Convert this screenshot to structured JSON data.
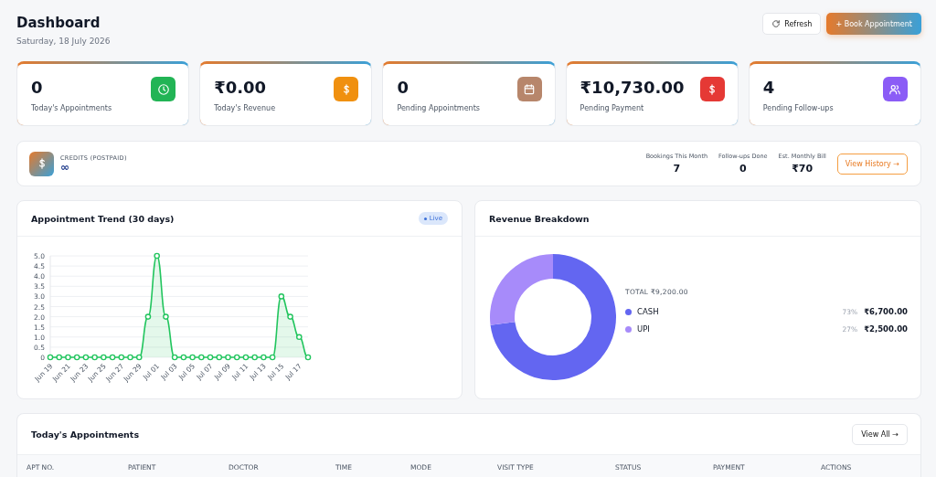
{
  "header": {
    "title": "Dashboard",
    "date": "Saturday, 18 July 2026",
    "buttons": [
      {
        "kind": "refresh",
        "label": "Refresh"
      },
      {
        "kind": "primary",
        "label": "+ Book Appointment"
      }
    ]
  },
  "stats": [
    {
      "value": "0",
      "label": "Today's Appointments",
      "color": "#22b455"
    },
    {
      "value": "₹0.00",
      "label": "Today's Revenue",
      "color": "#f0900f"
    },
    {
      "value": "0",
      "label": "Pending Appointments",
      "color": "#b7866b"
    },
    {
      "value": "₹10,730.00",
      "label": "Pending Payment",
      "color": "#e53935"
    },
    {
      "value": "4",
      "label": "Pending Follow-ups",
      "color": "#8b5cf6"
    }
  ],
  "credits": {
    "label": "CREDITS (POSTPAID)",
    "value": "∞",
    "metrics": [
      {
        "label": "Bookings This Month",
        "value": "7"
      },
      {
        "label": "Follow-ups Done",
        "value": "0"
      },
      {
        "label": "Est. Monthly Bill",
        "value": "₹70"
      }
    ],
    "button": "View History →"
  },
  "trend": {
    "title": "Appointment Trend (30 days)",
    "badge": "Live",
    "chart_data": {
      "type": "area",
      "grid": true,
      "categories": [
        "Jun 19",
        null,
        "Jun 21",
        null,
        "Jun 23",
        null,
        "Jun 25",
        null,
        "Jun 27",
        null,
        "Jun 29",
        null,
        "Jul 01",
        null,
        "Jul 03",
        null,
        "Jul 05",
        null,
        "Jul 07",
        null,
        "Jul 09",
        null,
        "Jul 11",
        null,
        "Jul 13",
        null,
        "Jul 15",
        null,
        "Jul 17",
        null
      ],
      "series": [
        {
          "color": "#22c55e",
          "values": [
            0,
            0,
            0,
            0,
            0,
            0,
            0,
            0,
            0,
            0,
            0,
            2,
            5,
            2,
            0,
            0,
            0,
            0,
            0,
            0,
            0,
            0,
            0,
            0,
            0,
            0,
            3,
            2,
            1,
            0
          ]
        }
      ],
      "ylim": [
        0,
        5
      ],
      "yticks": [
        {
          "value": 0,
          "label": "0"
        },
        {
          "value": 0.5,
          "label": "0.5"
        },
        {
          "value": 1,
          "label": "1.0"
        },
        {
          "value": 1.5,
          "label": "1.5"
        },
        {
          "value": 2,
          "label": "2.0"
        },
        {
          "value": 2.5,
          "label": "2.5"
        },
        {
          "value": 3,
          "label": "3.0"
        },
        {
          "value": 3.5,
          "label": "3.5"
        },
        {
          "value": 4,
          "label": "4.0"
        },
        {
          "value": 4.5,
          "label": "4.5"
        },
        {
          "value": 5,
          "label": "5.0"
        }
      ]
    }
  },
  "revenue": {
    "title": "Revenue Breakdown",
    "total": "TOTAL ₹9,200.00",
    "chart_data": {
      "type": "donut",
      "categories": [
        "CASH",
        "UPI"
      ],
      "series": [
        {
          "values": [
            73,
            27
          ]
        }
      ],
      "colors": [
        "#6366f1",
        "#a78bfa"
      ]
    },
    "legend": [
      {
        "percent": "73%",
        "amount": "₹6,700.00",
        "color": "#6366f1"
      },
      {
        "percent": "27%",
        "amount": "₹2,500.00",
        "color": "#a78bfa"
      }
    ]
  },
  "appointments": {
    "title": "Today's Appointments",
    "button": "View All →",
    "columns": [
      "APT NO.",
      "PATIENT",
      "DOCTOR",
      "TIME",
      "MODE",
      "VISIT TYPE",
      "STATUS",
      "PAYMENT",
      "ACTIONS"
    ]
  }
}
